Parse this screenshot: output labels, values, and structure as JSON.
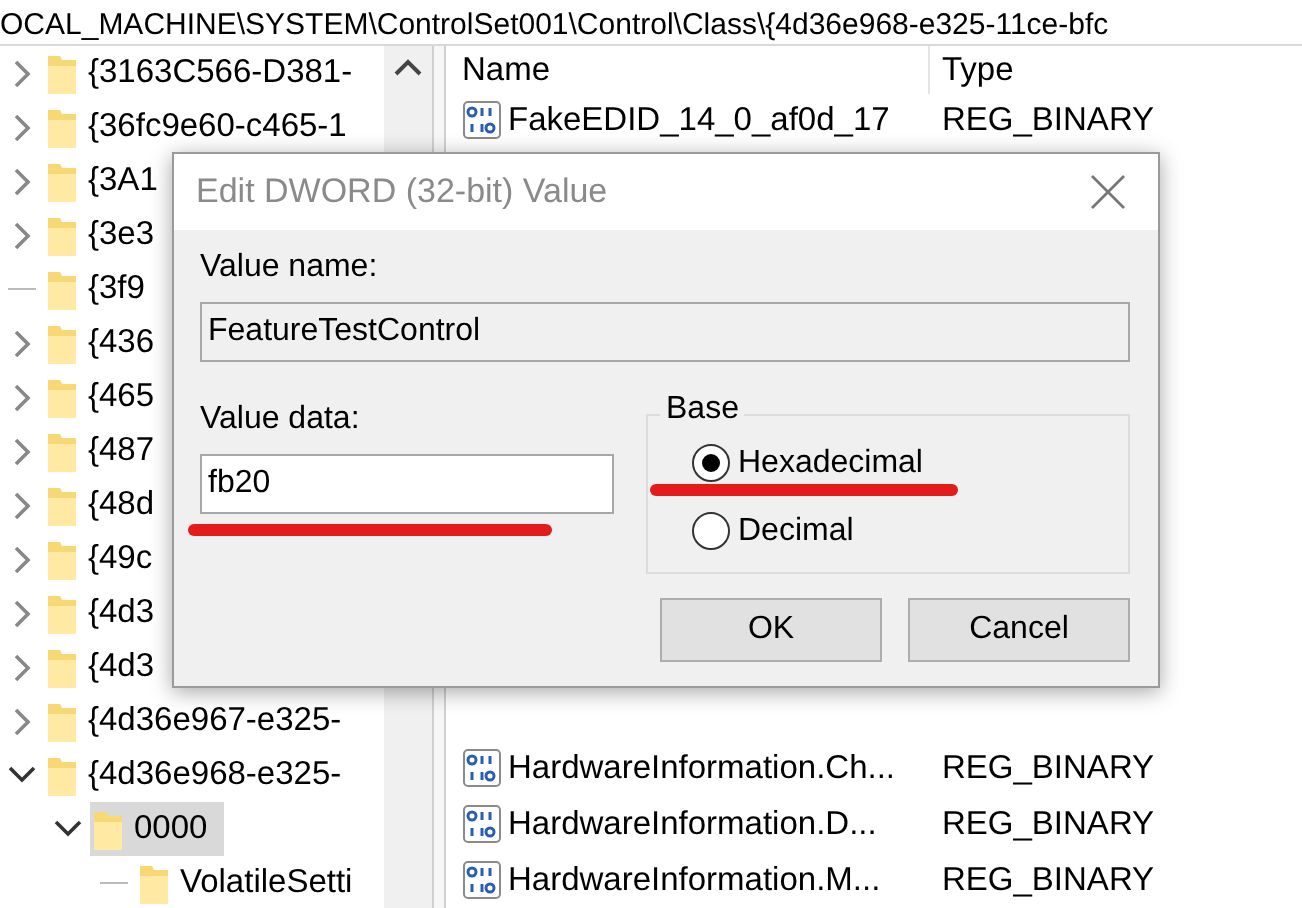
{
  "path_bar": {
    "text": "OCAL_MACHINE\\SYSTEM\\ControlSet001\\Control\\Class\\{4d36e968-e325-11ce-bfc"
  },
  "tree": {
    "items": [
      {
        "label": "{3163C566-D381-",
        "kind": "branch",
        "expanded": false,
        "selected": false
      },
      {
        "label": "{36fc9e60-c465-1",
        "kind": "branch",
        "expanded": false,
        "selected": false
      },
      {
        "label": "{3A1",
        "kind": "branch",
        "expanded": false,
        "selected": false
      },
      {
        "label": "{3e3",
        "kind": "branch",
        "expanded": false,
        "selected": false
      },
      {
        "label": "{3f9",
        "kind": "leaf",
        "selected": false
      },
      {
        "label": "{436",
        "kind": "branch",
        "expanded": false,
        "selected": false
      },
      {
        "label": "{465",
        "kind": "branch",
        "expanded": false,
        "selected": false
      },
      {
        "label": "{487",
        "kind": "branch",
        "expanded": false,
        "selected": false
      },
      {
        "label": "{48d",
        "kind": "branch",
        "expanded": false,
        "selected": false
      },
      {
        "label": "{49c",
        "kind": "branch",
        "expanded": false,
        "selected": false
      },
      {
        "label": "{4d3",
        "kind": "branch",
        "expanded": false,
        "selected": false
      },
      {
        "label": "{4d3",
        "kind": "branch",
        "expanded": false,
        "selected": false
      },
      {
        "label": "{4d36e967-e325-",
        "kind": "branch",
        "expanded": false,
        "selected": false
      },
      {
        "label": "{4d36e968-e325-",
        "kind": "branch",
        "expanded": true,
        "selected": false,
        "children": [
          {
            "label": "0000",
            "kind": "branch",
            "expanded": true,
            "selected": true,
            "children": [
              {
                "label": "VolatileSetti",
                "kind": "leaf",
                "selected": false
              }
            ]
          }
        ]
      }
    ]
  },
  "list": {
    "columns": [
      "Name",
      "Type"
    ],
    "rows": [
      {
        "name": "FakeEDID_14_0_af0d_17",
        "type": "REG_BINARY"
      },
      {
        "name": "HardwareInformation.Ch...",
        "type": "REG_BINARY"
      },
      {
        "name": "HardwareInformation.D...",
        "type": "REG_BINARY"
      },
      {
        "name": "HardwareInformation.M...",
        "type": "REG_BINARY"
      }
    ]
  },
  "dialog": {
    "title": "Edit DWORD (32-bit) Value",
    "value_name": {
      "label": "Value name:",
      "value": "FeatureTestControl"
    },
    "value_data": {
      "label": "Value data:",
      "value": "fb20"
    },
    "base": {
      "label": "Base",
      "options": [
        {
          "label": "Hexadecimal",
          "selected": true
        },
        {
          "label": "Decimal",
          "selected": false
        }
      ]
    },
    "buttons": [
      "OK",
      "Cancel"
    ]
  }
}
